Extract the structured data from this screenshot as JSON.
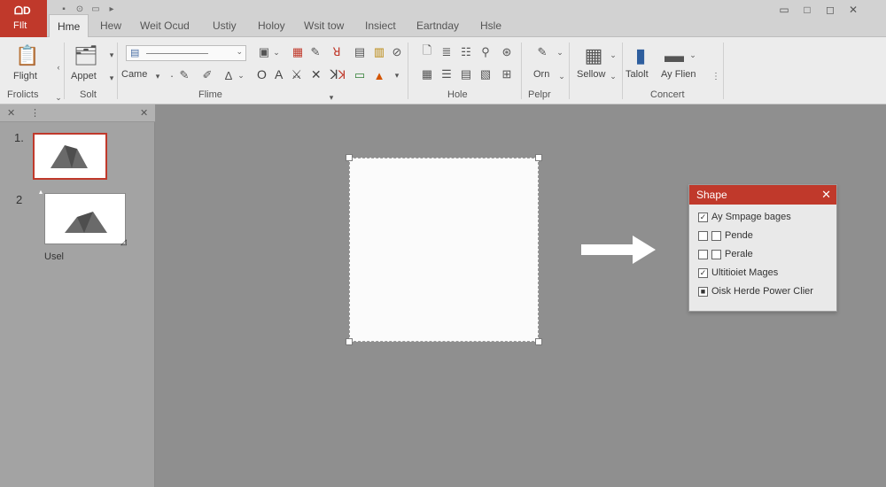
{
  "titlebar": {
    "file_logo": "ᗝD",
    "file_label": "FIlt",
    "tabs": [
      {
        "label": "Hme",
        "active": true
      },
      {
        "label": "Hew"
      },
      {
        "label": "Weit Ocud"
      },
      {
        "label": "Ustiy"
      },
      {
        "label": "Holoy"
      },
      {
        "label": "Wsit tow"
      },
      {
        "label": "Insiect"
      },
      {
        "label": "Eartnday"
      },
      {
        "label": "Hsle"
      }
    ]
  },
  "ribbon": {
    "groups": {
      "g1_label": "Frolicts",
      "g2_label": "Solt",
      "g3_label": "Flime",
      "g4_label": "Hole",
      "g5_label": "Pelpr",
      "g6_label": "Concert"
    },
    "buttons": {
      "flight": "Flight",
      "appet": "Appet",
      "came": "Came",
      "orn": "Orn",
      "sellow": "Sellow",
      "talolt": "Talolt",
      "ay_flien": "Ay Flien"
    },
    "font_row": "O A ⚔ ✕ ꓘ"
  },
  "slides_pane": {
    "slides": [
      {
        "number": "1.",
        "selected": true
      },
      {
        "number": "2",
        "caption": "Usel"
      }
    ]
  },
  "shape_dialog": {
    "title": "Shape",
    "options": [
      {
        "label": "Ay Smpage bages",
        "checked": true
      },
      {
        "label": "Pende",
        "checked": false
      },
      {
        "label": "Perale",
        "checked": false
      },
      {
        "label": "Ultitioiet Mages",
        "checked": true
      },
      {
        "label": "Oisk Herde Power Clier",
        "checked": true
      }
    ]
  }
}
